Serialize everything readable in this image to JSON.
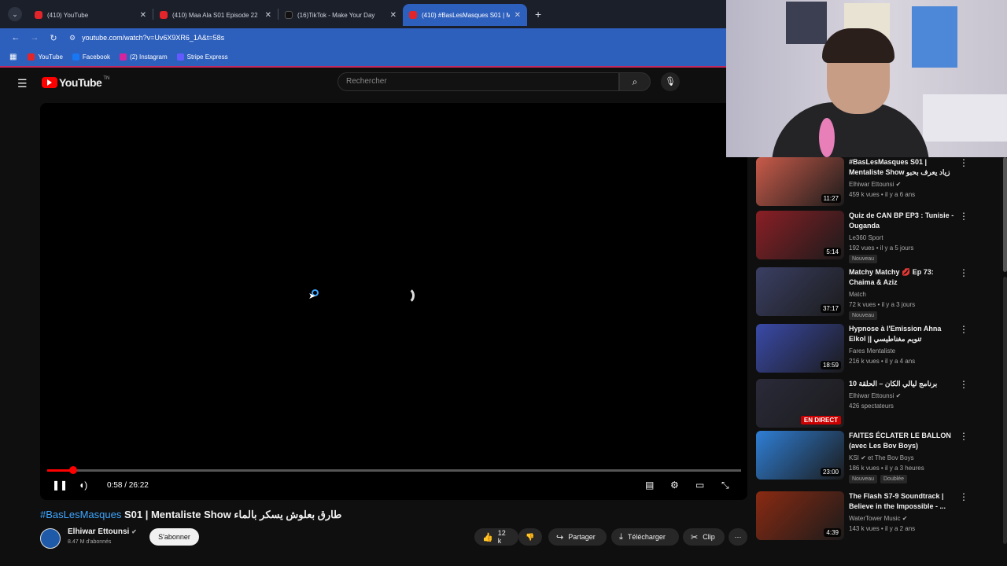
{
  "browser": {
    "tabs": [
      {
        "title": "(410) YouTube",
        "icon": "youtube"
      },
      {
        "title": "(410) Maa Ala S01 Episode 22",
        "icon": "youtube"
      },
      {
        "title": "(16)TikTok - Make Your Day",
        "icon": "tiktok"
      },
      {
        "title": "(410) #BasLesMasques S01 | M",
        "icon": "youtube"
      }
    ],
    "url": "youtube.com/watch?v=Uv6X9XR6_1A&t=58s",
    "bookmarks": [
      "YouTube",
      "Facebook",
      "(2) Instagram",
      "Stripe Express"
    ]
  },
  "header": {
    "logo_text": "YouTube",
    "logo_region": "TN",
    "search_placeholder": "Rechercher"
  },
  "player": {
    "current_time": "0:58",
    "duration": "26:22",
    "time_display": "0:58 / 26:22",
    "progress_fraction": 0.037
  },
  "video": {
    "title_tag": "#BasLesMasques",
    "title_rest": " S01 | Mentaliste Show طارق بعلوش يسكر بالماء",
    "channel": "Elhiwar Ettounsi",
    "subscribers": "8.47 M d'abonnés",
    "subscribe_label": "S'abonner",
    "likes": "12 k",
    "share_label": "Partager",
    "download_label": "Télécharger",
    "clip_label": "Clip"
  },
  "recommendations": [
    {
      "title": "#BasLesMasques S01 | Mentaliste Show زياد يعرف بحبو ل",
      "channel": "Elhiwar Ettounsi",
      "verified": true,
      "meta": "459 k vues • il y a 6 ans",
      "duration": "11:27",
      "thumb": "#c95b4a"
    },
    {
      "title": "Quiz de CAN BP EP3 : Tunisie - Ouganda",
      "channel": "Le360 Sport",
      "verified": false,
      "meta": "192 vues • il y a 5 jours",
      "badge": "Nouveau",
      "duration": "5:14",
      "thumb": "#8a1f25"
    },
    {
      "title": "Matchy Matchy 💋 Ep 73: Chaima & Aziz",
      "channel": "Match",
      "verified": false,
      "meta": "72 k vues • il y a 3 jours",
      "badge": "Nouveau",
      "duration": "37:17",
      "thumb": "#3a3f63"
    },
    {
      "title": "Hypnose à l'Emission Ahna Elkol || تنويم مغناطيسي",
      "channel": "Fares Mentaliste",
      "verified": false,
      "meta": "216 k vues • il y a 4 ans",
      "duration": "18:59",
      "thumb": "#3a4aa8"
    },
    {
      "title": "برنامج ليالي الكان – الحلقة 10",
      "channel": "Elhiwar Ettounsi",
      "verified": true,
      "meta": "426 spectateurs",
      "live": "EN DIRECT",
      "thumb": "#2a2a3a"
    },
    {
      "title": "FAITES ÉCLATER LE BALLON (avec Les Bov Boys)",
      "channel": "KSI",
      "verified": true,
      "channel_extra": "et The Bov Boys",
      "meta": "186 k vues • il y a 3 heures",
      "badge": "Nouveau",
      "badge2": "Doublée",
      "duration": "23:00",
      "thumb": "#2f7fd6"
    },
    {
      "title": "The Flash S7-9 Soundtrack | Believe in the Impossible - ...",
      "channel": "WaterTower Music",
      "verified": true,
      "meta": "143 k vues • il y a 2 ans",
      "duration": "4:39",
      "thumb": "#8a2a12"
    }
  ],
  "icons": {
    "tab_menu": "chevron-down-icon",
    "close": "close-icon",
    "search": "search-icon",
    "mic": "mic-icon",
    "pause": "pause-icon",
    "volume": "volume-icon",
    "subtitles": "subtitles-icon",
    "settings": "settings-icon",
    "miniplayer": "miniplayer-icon",
    "fullscreen": "fullscreen-icon",
    "like": "like-icon",
    "dislike": "dislike-icon",
    "share": "share-icon",
    "download": "download-icon",
    "clip": "clip-icon",
    "more": "more-icon"
  }
}
